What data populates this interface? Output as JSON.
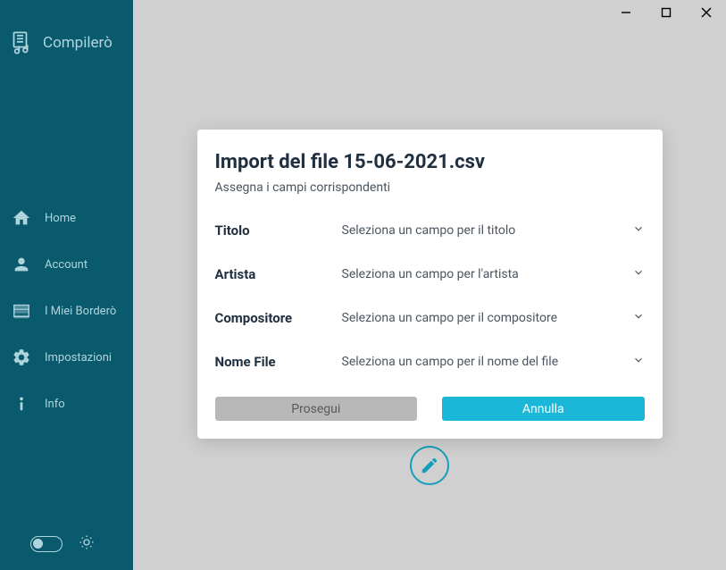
{
  "app": {
    "name": "Compilerò"
  },
  "sidebar": {
    "items": [
      {
        "label": "Home"
      },
      {
        "label": "Account"
      },
      {
        "label": "I Miei Borderò"
      },
      {
        "label": "Impostazioni"
      },
      {
        "label": "Info"
      }
    ]
  },
  "modal": {
    "title": "Import del file 15-06-2021.csv",
    "subtitle": "Assegna i campi corrispondenti",
    "fields": [
      {
        "label": "Titolo",
        "placeholder": "Seleziona un campo per il titolo"
      },
      {
        "label": "Artista",
        "placeholder": "Seleziona un campo per l'artista"
      },
      {
        "label": "Compositore",
        "placeholder": "Seleziona un campo per il compositore"
      },
      {
        "label": "Nome File",
        "placeholder": "Seleziona un campo per il nome del file"
      }
    ],
    "buttons": {
      "proceed": "Prosegui",
      "cancel": "Annulla"
    }
  }
}
